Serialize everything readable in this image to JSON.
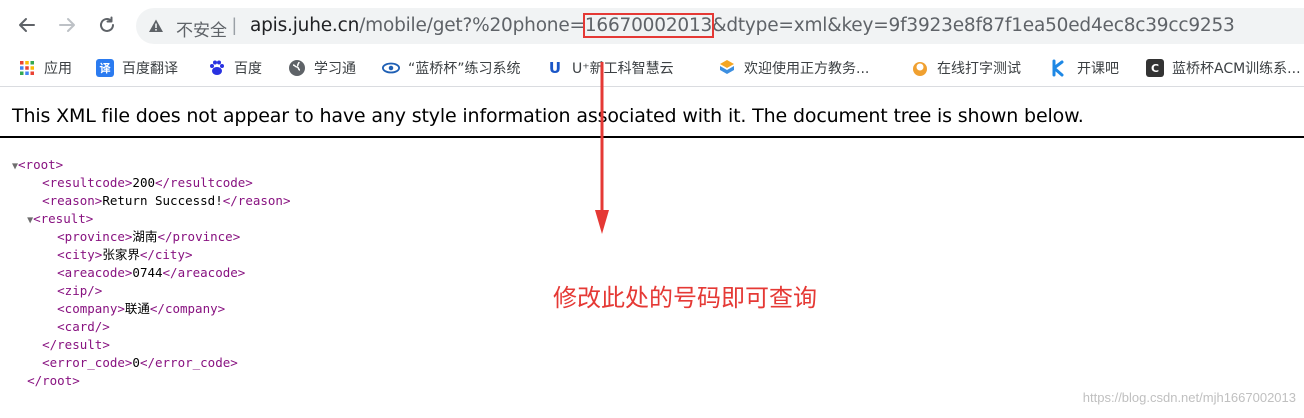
{
  "browser": {
    "security_label": "不安全",
    "url_host": "apis.juhe.cn",
    "url_path_prefix": "/mobile/get?%20phone=",
    "url_phone": "16670002013",
    "url_suffix": "&dtype=xml&key=9f3923e8f87f1ea50ed4ec8c39cc9253"
  },
  "bookmarks": [
    {
      "label": "应用",
      "icon": "apps-grid-icon"
    },
    {
      "label": "百度翻译",
      "icon": "baidu-translate-icon"
    },
    {
      "label": "百度",
      "icon": "baidu-paw-icon"
    },
    {
      "label": "学习通",
      "icon": "globe-icon"
    },
    {
      "label": "“蓝桥杯”练习系统",
      "icon": "lanqiao-icon"
    },
    {
      "label": "U⁺新工科智慧云",
      "icon": "uplus-icon"
    },
    {
      "label": "欢迎使用正方教务...",
      "icon": "zhengfang-icon"
    },
    {
      "label": "在线打字测试",
      "icon": "typing-test-icon"
    },
    {
      "label": "开课吧",
      "icon": "kaikeba-icon"
    },
    {
      "label": "蓝桥杯ACM训练系...",
      "icon": "acm-icon"
    }
  ],
  "page": {
    "xml_notice": "This XML file does not appear to have any style information associated with it. The document tree is shown below.",
    "annotation": "修改此处的号码即可查询",
    "watermark": "https://blog.csdn.net/mjh1667002013"
  },
  "xml_tree": {
    "resultcode": "200",
    "reason": "Return Successd!",
    "province": "湖南",
    "city": "张家界",
    "areacode": "0744",
    "company": "联通",
    "error_code": "0"
  },
  "colors": {
    "annotation_red": "#e53935",
    "xml_tag": "#881280"
  }
}
